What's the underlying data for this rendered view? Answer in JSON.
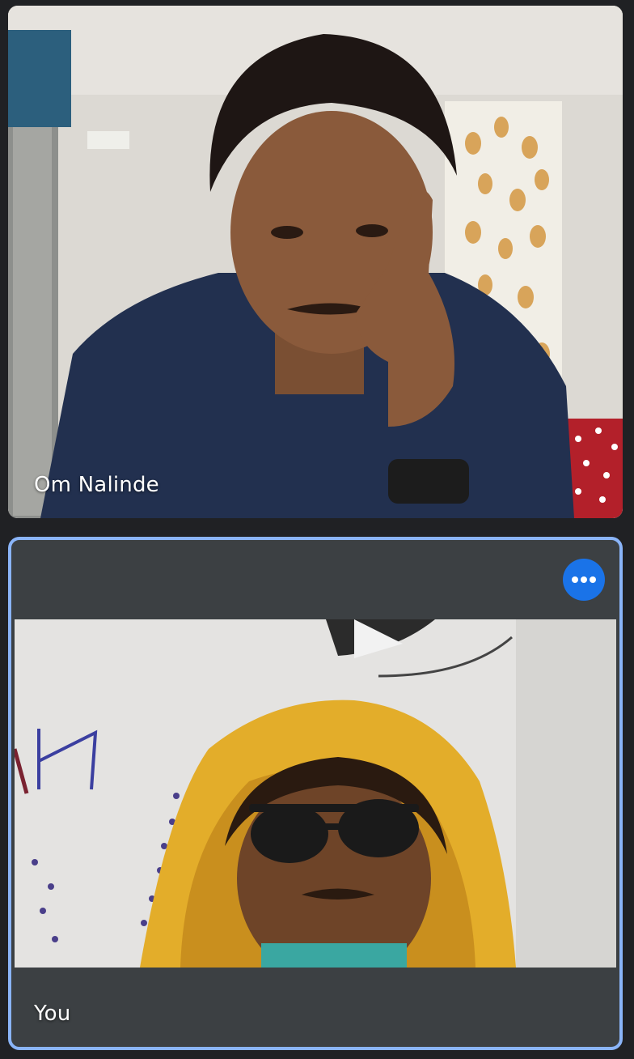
{
  "participants": [
    {
      "name": "Om Nalinde",
      "role": "remote"
    },
    {
      "name": "You",
      "role": "self"
    }
  ],
  "controls": {
    "more_options_icon": "more-horiz-icon"
  },
  "colors": {
    "background": "#202124",
    "tile_dark": "#3c4043",
    "active_speaker_border": "#8ab4f8",
    "more_button": "#1a73e8"
  }
}
